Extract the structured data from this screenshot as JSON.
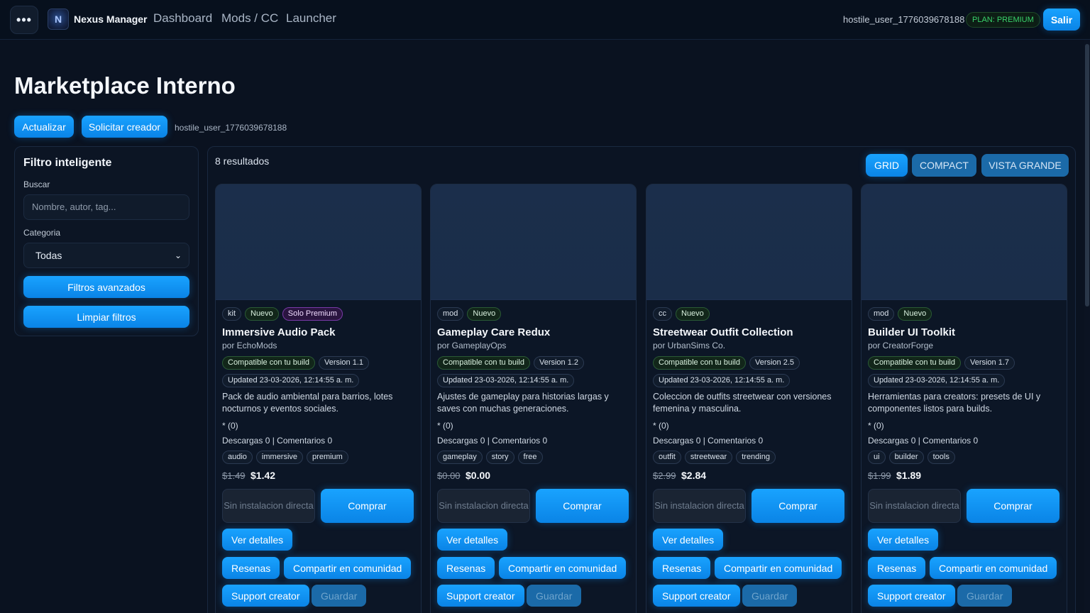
{
  "topbar": {
    "menu_icon": "ellipsis-icon",
    "logo_icon": "nexus-logo",
    "brand": "Nexus Manager",
    "nav": [
      "Dashboard",
      "Mods / CC",
      "Launcher"
    ],
    "username": "hostile_user_1776039678188",
    "plan": "PLAN: PREMIUM",
    "logout": "Salir"
  },
  "header": {
    "title": "Marketplace Interno",
    "refresh": "Actualizar",
    "request_creator": "Solicitar creador",
    "username": "hostile_user_1776039678188"
  },
  "filters": {
    "title": "Filtro inteligente",
    "search_label": "Buscar",
    "search_placeholder": "Nombre, autor, tag...",
    "category_label": "Categoria",
    "category_value": "Todas",
    "advanced": "Filtros avanzados",
    "clear": "Limpiar filtros"
  },
  "results": {
    "count": "8 resultados",
    "views": [
      "GRID",
      "COMPACT",
      "VISTA GRANDE"
    ],
    "active_view": "GRID"
  },
  "card_labels": {
    "no_install": "Sin instalacion directa",
    "buy": "Comprar",
    "details": "Ver detalles",
    "reviews": "Resenas",
    "share": "Compartir en comunidad",
    "support": "Support creator",
    "save": "Guardar"
  },
  "cards": [
    {
      "type": "kit",
      "is_new": "Nuevo",
      "premium": "Solo Premium",
      "title": "Immersive Audio Pack",
      "author": "por EchoMods",
      "compat": "Compatible con tu build",
      "version": "Version 1.1",
      "updated": "Updated 23-03-2026, 12:14:55 a. m.",
      "desc": "Pack de audio ambiental para barrios, lotes nocturnos y eventos sociales.",
      "rating": "* (0)",
      "stats": "Descargas 0 | Comentarios 0",
      "tags": [
        "audio",
        "immersive",
        "premium"
      ],
      "price_old": "$1.49",
      "price_new": "$1.42"
    },
    {
      "type": "mod",
      "is_new": "Nuevo",
      "premium": "",
      "title": "Gameplay Care Redux",
      "author": "por GameplayOps",
      "compat": "Compatible con tu build",
      "version": "Version 1.2",
      "updated": "Updated 23-03-2026, 12:14:55 a. m.",
      "desc": "Ajustes de gameplay para historias largas y saves con muchas generaciones.",
      "rating": "* (0)",
      "stats": "Descargas 0 | Comentarios 0",
      "tags": [
        "gameplay",
        "story",
        "free"
      ],
      "price_old": "$0.00",
      "price_new": "$0.00"
    },
    {
      "type": "cc",
      "is_new": "Nuevo",
      "premium": "",
      "title": "Streetwear Outfit Collection",
      "author": "por UrbanSims Co.",
      "compat": "Compatible con tu build",
      "version": "Version 2.5",
      "updated": "Updated 23-03-2026, 12:14:55 a. m.",
      "desc": "Coleccion de outfits streetwear con versiones femenina y masculina.",
      "rating": "* (0)",
      "stats": "Descargas 0 | Comentarios 0",
      "tags": [
        "outfit",
        "streetwear",
        "trending"
      ],
      "price_old": "$2.99",
      "price_new": "$2.84"
    },
    {
      "type": "mod",
      "is_new": "Nuevo",
      "premium": "",
      "title": "Builder UI Toolkit",
      "author": "por CreatorForge",
      "compat": "Compatible con tu build",
      "version": "Version 1.7",
      "updated": "Updated 23-03-2026, 12:14:55 a. m.",
      "desc": "Herramientas para creators: presets de UI y componentes listos para builds.",
      "rating": "* (0)",
      "stats": "Descargas 0 | Comentarios 0",
      "tags": [
        "ui",
        "builder",
        "tools"
      ],
      "price_old": "$1.99",
      "price_new": "$1.89"
    }
  ]
}
